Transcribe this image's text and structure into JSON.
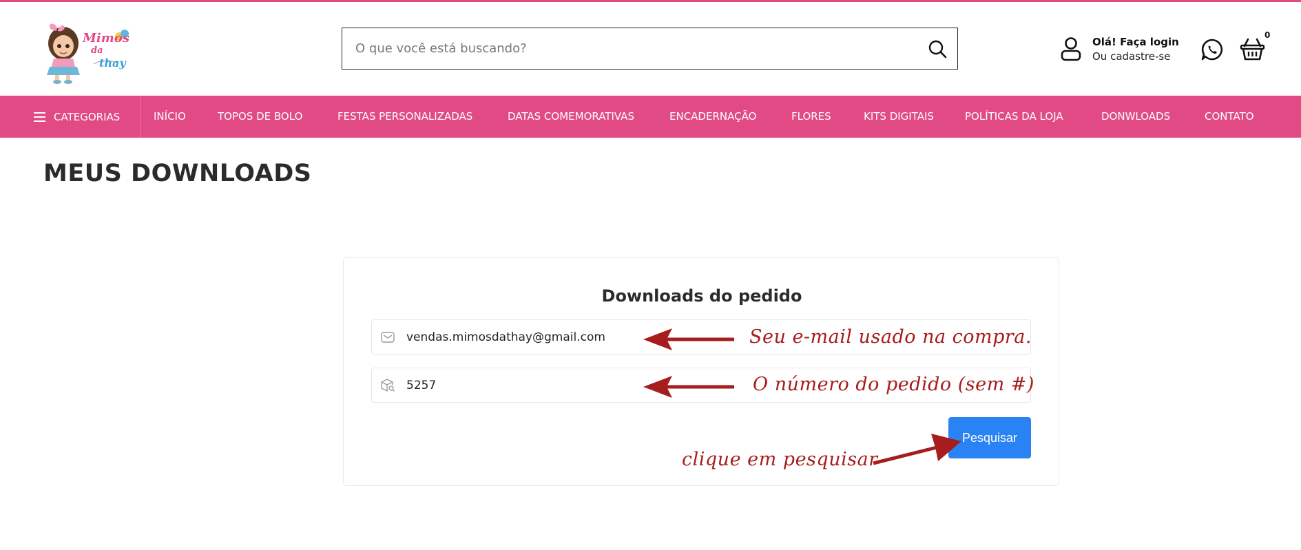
{
  "header": {
    "logo": {
      "line1": "Mimos",
      "line2": "da",
      "line3": "thay"
    },
    "search": {
      "placeholder": "O que você está buscando?"
    },
    "login": {
      "title": "Olá! Faça login",
      "subtitle": "Ou cadastre-se"
    },
    "cart": {
      "count": "0"
    }
  },
  "nav": {
    "categories_label": "CATEGORIAS",
    "items": [
      {
        "label": "INÍCIO"
      },
      {
        "label": "TOPOS DE BOLO"
      },
      {
        "label": "FESTAS PERSONALIZADAS"
      },
      {
        "label": "DATAS COMEMORATIVAS"
      },
      {
        "label": "ENCADERNAÇÃO"
      },
      {
        "label": "FLORES"
      },
      {
        "label": "KITS DIGITAIS"
      },
      {
        "label": "POLÍTICAS DA LOJA"
      },
      {
        "label": "DONWLOADS"
      },
      {
        "label": "CONTATO"
      }
    ]
  },
  "main": {
    "title": "MEUS DOWNLOADS",
    "card": {
      "title": "Downloads do pedido",
      "email": {
        "value": "vendas.mimosdathay@gmail.com"
      },
      "order": {
        "value": "5257"
      },
      "button_label": "Pesquisar"
    }
  },
  "annotations": {
    "email_hint": "Seu e-mail usado na compra.",
    "order_hint": "O número do pedido (sem #)",
    "button_hint": "clique em pesquisar"
  },
  "colors": {
    "brand_pink": "#e24a86",
    "button_blue": "#2a83f5",
    "annotation_red": "#a71c1c"
  }
}
